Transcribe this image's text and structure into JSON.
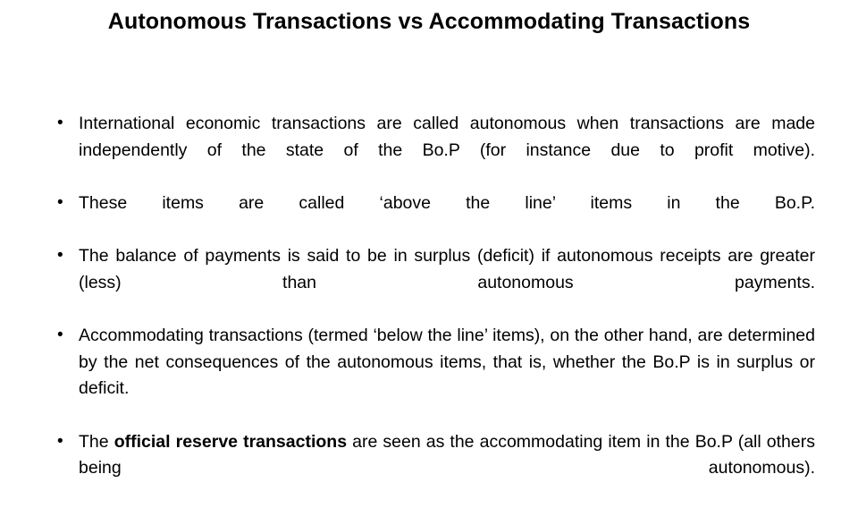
{
  "slide": {
    "title": "Autonomous Transactions vs  Accommodating Transactions",
    "bullets": [
      {
        "text_before": "International economic transactions are called autonomous when transactions are made independently of the state of the Bo.P (for instance due to profit motive).",
        "bold": "",
        "text_after": ""
      },
      {
        "text_before": "These items are called ‘above the line’ items in the Bo.P.",
        "bold": "",
        "text_after": ""
      },
      {
        "text_before": "The balance of payments is said to be in surplus (deficit) if autonomous receipts are greater (less) than autonomous payments.",
        "bold": "",
        "text_after": ""
      },
      {
        "text_before": "Accommodating transactions (termed ‘below the line’ items), on the other hand, are determined by the net consequences of the autonomous items, that is, whether the Bo.P is in surplus or deficit.",
        "bold": "",
        "text_after": ""
      },
      {
        "text_before": "The ",
        "bold": "official reserve transactions",
        "text_after": " are seen as the accommodating item in the Bo.P (all others being autonomous)."
      }
    ]
  }
}
